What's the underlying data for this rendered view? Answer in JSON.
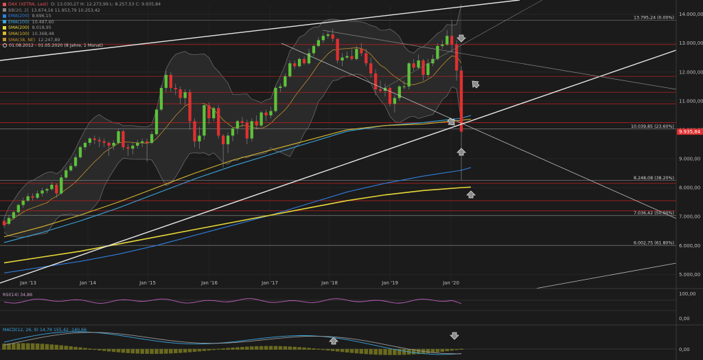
{
  "legend": {
    "header": {
      "label": "DAX (XETRA, Last)",
      "values": "O: 13.030,27  H: 12.273,99  L: 8.257,53  C: 9.935,84",
      "color": "#e05050"
    },
    "rows": [
      {
        "name": "BB(20, 2)",
        "values": "13.674,16  11.953,79  10.253,42",
        "color": "#888888"
      },
      {
        "name": "EMA(200)",
        "values": "8.696,15",
        "color": "#2f7fe0"
      },
      {
        "name": "EMA(100)",
        "values": "10.497,60",
        "color": "#3aa6e0"
      },
      {
        "name": "SMA(200)",
        "values": "8.018,95",
        "color": "#e8d838"
      },
      {
        "name": "SMA(100)",
        "values": "10.368,48",
        "color": "#d8b830"
      },
      {
        "name": "SMA(38, NE)",
        "values": "12.247,89",
        "color": "#c09030"
      }
    ],
    "range": "01.08.2012 - 01.05.2020  (8 Jahre, 1 Monat)"
  },
  "chart_data": {
    "type": "candlestick",
    "x_ticks": [
      "Jan '13",
      "Jan '14",
      "Jan '15",
      "Jan '16",
      "Jan '17",
      "Jan '18",
      "Jan '19",
      "Jan '20"
    ],
    "y_ticks": [
      "14.000,00",
      "13.000,00",
      "12.000,00",
      "11.000,00",
      "10.000,00",
      "9.000,00",
      "8.000,00",
      "7.000,00",
      "6.000,00",
      "5.000,00"
    ],
    "ylim": [
      4700,
      14300
    ],
    "fib_levels": [
      {
        "value": 13795.24,
        "label": "13.795,24 (0.00%)"
      },
      {
        "value": 10039.85,
        "label": "10.039,85 (23.60%)"
      },
      {
        "value": 8248.08,
        "label": "8.248,08 (38.20%)"
      },
      {
        "value": 7036.42,
        "label": "7.036,42 (50.00%)"
      },
      {
        "value": 6002.75,
        "label": "6.002,75 (61.80%)"
      }
    ],
    "red_levels": [
      12950,
      11850,
      11300,
      10900,
      10250,
      8150,
      7550,
      7200
    ],
    "last_price": {
      "value": 9935.84,
      "label": "9.935,84",
      "color": "#e03030"
    },
    "candles": [
      [
        6850,
        6700,
        6950,
        6600
      ],
      [
        6750,
        6950,
        7050,
        6700
      ],
      [
        6950,
        7150,
        7200,
        6900
      ],
      [
        7150,
        7400,
        7450,
        7100
      ],
      [
        7400,
        7550,
        7650,
        7300
      ],
      [
        7550,
        7700,
        7800,
        7500
      ],
      [
        7700,
        7650,
        7800,
        7550
      ],
      [
        7650,
        7800,
        7900,
        7600
      ],
      [
        7800,
        7900,
        8000,
        7700
      ],
      [
        7900,
        7950,
        8000,
        7800
      ],
      [
        7950,
        8100,
        8200,
        7900
      ],
      [
        8100,
        7800,
        8150,
        7650
      ],
      [
        7800,
        8350,
        8450,
        7750
      ],
      [
        8350,
        8600,
        8700,
        8300
      ],
      [
        8600,
        8750,
        8850,
        8550
      ],
      [
        8750,
        9050,
        9150,
        8700
      ],
      [
        9050,
        9400,
        9450,
        9000
      ],
      [
        9400,
        9550,
        9600,
        9300
      ],
      [
        9550,
        9700,
        9750,
        9450
      ],
      [
        9700,
        9650,
        9800,
        9500
      ],
      [
        9650,
        9600,
        9750,
        9400
      ],
      [
        9600,
        9550,
        9700,
        9400
      ],
      [
        9550,
        9450,
        9600,
        9100
      ],
      [
        9450,
        9550,
        9650,
        9300
      ],
      [
        9550,
        9950,
        10050,
        9500
      ],
      [
        9950,
        9400,
        10000,
        9300
      ],
      [
        9400,
        9350,
        9500,
        9100
      ],
      [
        9350,
        9450,
        9550,
        9150
      ],
      [
        9450,
        9550,
        9650,
        9350
      ],
      [
        9550,
        9600,
        9700,
        9400
      ],
      [
        9600,
        9550,
        9700,
        8900
      ],
      [
        9550,
        9850,
        9950,
        9500
      ],
      [
        9850,
        10700,
        10750,
        9800
      ],
      [
        10700,
        11450,
        11550,
        10650
      ],
      [
        11450,
        11900,
        12050,
        11300
      ],
      [
        11900,
        11450,
        12000,
        11300
      ],
      [
        11450,
        11400,
        11600,
        11200
      ],
      [
        11400,
        11100,
        11500,
        10900
      ],
      [
        11100,
        11300,
        11400,
        10850
      ],
      [
        11300,
        10300,
        11400,
        10000
      ],
      [
        10300,
        9600,
        10400,
        9400
      ],
      [
        9600,
        9800,
        10100,
        9350
      ],
      [
        9800,
        10850,
        10900,
        9650
      ],
      [
        10850,
        10400,
        10950,
        10200
      ],
      [
        10400,
        10750,
        10800,
        10300
      ],
      [
        10750,
        9800,
        10850,
        9700
      ],
      [
        9800,
        9500,
        9850,
        8700
      ],
      [
        9500,
        9800,
        9900,
        9200
      ],
      [
        9800,
        10050,
        10100,
        9600
      ],
      [
        10050,
        10300,
        10350,
        9850
      ],
      [
        10300,
        10250,
        10450,
        10100
      ],
      [
        10250,
        9700,
        10350,
        9500
      ],
      [
        9700,
        10300,
        10400,
        9600
      ],
      [
        10300,
        10150,
        10500,
        10000
      ],
      [
        10150,
        10600,
        10650,
        10100
      ],
      [
        10600,
        10500,
        10700,
        10300
      ],
      [
        10500,
        10650,
        10800,
        10400
      ],
      [
        10650,
        11450,
        11500,
        10600
      ],
      [
        11450,
        11500,
        11600,
        11300
      ],
      [
        11500,
        11850,
        11950,
        11450
      ],
      [
        11850,
        12300,
        12400,
        11800
      ],
      [
        12300,
        12200,
        12400,
        12100
      ],
      [
        12200,
        12450,
        12500,
        12150
      ],
      [
        12450,
        12300,
        12550,
        12250
      ],
      [
        12300,
        12650,
        12800,
        12250
      ],
      [
        12650,
        12900,
        12950,
        12550
      ],
      [
        12900,
        13100,
        13200,
        12850
      ],
      [
        13100,
        13250,
        13350,
        13000
      ],
      [
        13250,
        13300,
        13400,
        13150
      ],
      [
        13300,
        13150,
        13500,
        13050
      ],
      [
        13150,
        12400,
        13150,
        12300
      ],
      [
        12400,
        12500,
        12650,
        12200
      ],
      [
        12500,
        12550,
        12700,
        12450
      ],
      [
        12550,
        12450,
        12800,
        12400
      ],
      [
        12450,
        12800,
        12900,
        12400
      ],
      [
        12800,
        12650,
        13000,
        12550
      ],
      [
        12650,
        12300,
        12800,
        12200
      ],
      [
        12300,
        11950,
        12500,
        11800
      ],
      [
        11950,
        11400,
        12100,
        11200
      ],
      [
        11400,
        11350,
        11700,
        11300
      ],
      [
        11350,
        11450,
        11600,
        11150
      ],
      [
        11450,
        10900,
        11500,
        10800
      ],
      [
        10900,
        11100,
        11200,
        10600
      ],
      [
        11100,
        11500,
        11550,
        11000
      ],
      [
        11500,
        11500,
        11700,
        11400
      ],
      [
        11500,
        12300,
        12350,
        11400
      ],
      [
        12300,
        12150,
        12450,
        12050
      ],
      [
        12150,
        12400,
        12600,
        12100
      ],
      [
        12400,
        11900,
        12450,
        11700
      ],
      [
        11900,
        12300,
        12450,
        11800
      ],
      [
        12300,
        12450,
        12600,
        12200
      ],
      [
        12450,
        12900,
        13000,
        12400
      ],
      [
        12900,
        12950,
        13100,
        12800
      ],
      [
        12950,
        13250,
        13450,
        12900
      ],
      [
        13250,
        12950,
        13800,
        12700
      ],
      [
        12950,
        12050,
        13100,
        11700
      ],
      [
        12050,
        9936,
        12200,
        8257
      ]
    ],
    "series": [
      {
        "name": "EMA(200)",
        "color": "#2f7fe0",
        "values": [
          [
            0,
            5050
          ],
          [
            8,
            5250
          ],
          [
            16,
            5450
          ],
          [
            24,
            5700
          ],
          [
            32,
            6000
          ],
          [
            40,
            6350
          ],
          [
            48,
            6700
          ],
          [
            56,
            7050
          ],
          [
            64,
            7450
          ],
          [
            72,
            7850
          ],
          [
            80,
            8150
          ],
          [
            88,
            8400
          ],
          [
            96,
            8600
          ],
          [
            98,
            8696
          ]
        ]
      },
      {
        "name": "SMA(200)",
        "color": "#e8d838",
        "values": [
          [
            0,
            5400
          ],
          [
            8,
            5600
          ],
          [
            16,
            5800
          ],
          [
            24,
            6050
          ],
          [
            32,
            6300
          ],
          [
            40,
            6550
          ],
          [
            48,
            6800
          ],
          [
            56,
            7050
          ],
          [
            64,
            7300
          ],
          [
            72,
            7550
          ],
          [
            80,
            7750
          ],
          [
            88,
            7900
          ],
          [
            96,
            8000
          ],
          [
            98,
            8019
          ]
        ]
      },
      {
        "name": "EMA(100)",
        "color": "#3aa6e0",
        "values": [
          [
            0,
            6100
          ],
          [
            8,
            6450
          ],
          [
            16,
            6850
          ],
          [
            24,
            7300
          ],
          [
            32,
            7800
          ],
          [
            40,
            8300
          ],
          [
            48,
            8750
          ],
          [
            56,
            9150
          ],
          [
            64,
            9550
          ],
          [
            72,
            9950
          ],
          [
            80,
            10150
          ],
          [
            88,
            10250
          ],
          [
            96,
            10400
          ],
          [
            98,
            10498
          ]
        ]
      },
      {
        "name": "SMA(100)",
        "color": "#d8b830",
        "values": [
          [
            0,
            6300
          ],
          [
            8,
            6650
          ],
          [
            16,
            7050
          ],
          [
            24,
            7500
          ],
          [
            32,
            8000
          ],
          [
            40,
            8500
          ],
          [
            48,
            8950
          ],
          [
            56,
            9300
          ],
          [
            64,
            9650
          ],
          [
            72,
            10000
          ],
          [
            80,
            10150
          ],
          [
            88,
            10200
          ],
          [
            96,
            10330
          ],
          [
            98,
            10368
          ]
        ]
      }
    ],
    "indicators": {
      "rsi": {
        "label": "RSI(14)",
        "value": "34,86",
        "color": "#c060c0",
        "axis": [
          "100,00",
          "0,00"
        ]
      },
      "macd": {
        "label": "MACD(12, 26, 9)",
        "values": "14,79  155,42  -140,66",
        "axis": [
          "0,00"
        ]
      }
    }
  }
}
